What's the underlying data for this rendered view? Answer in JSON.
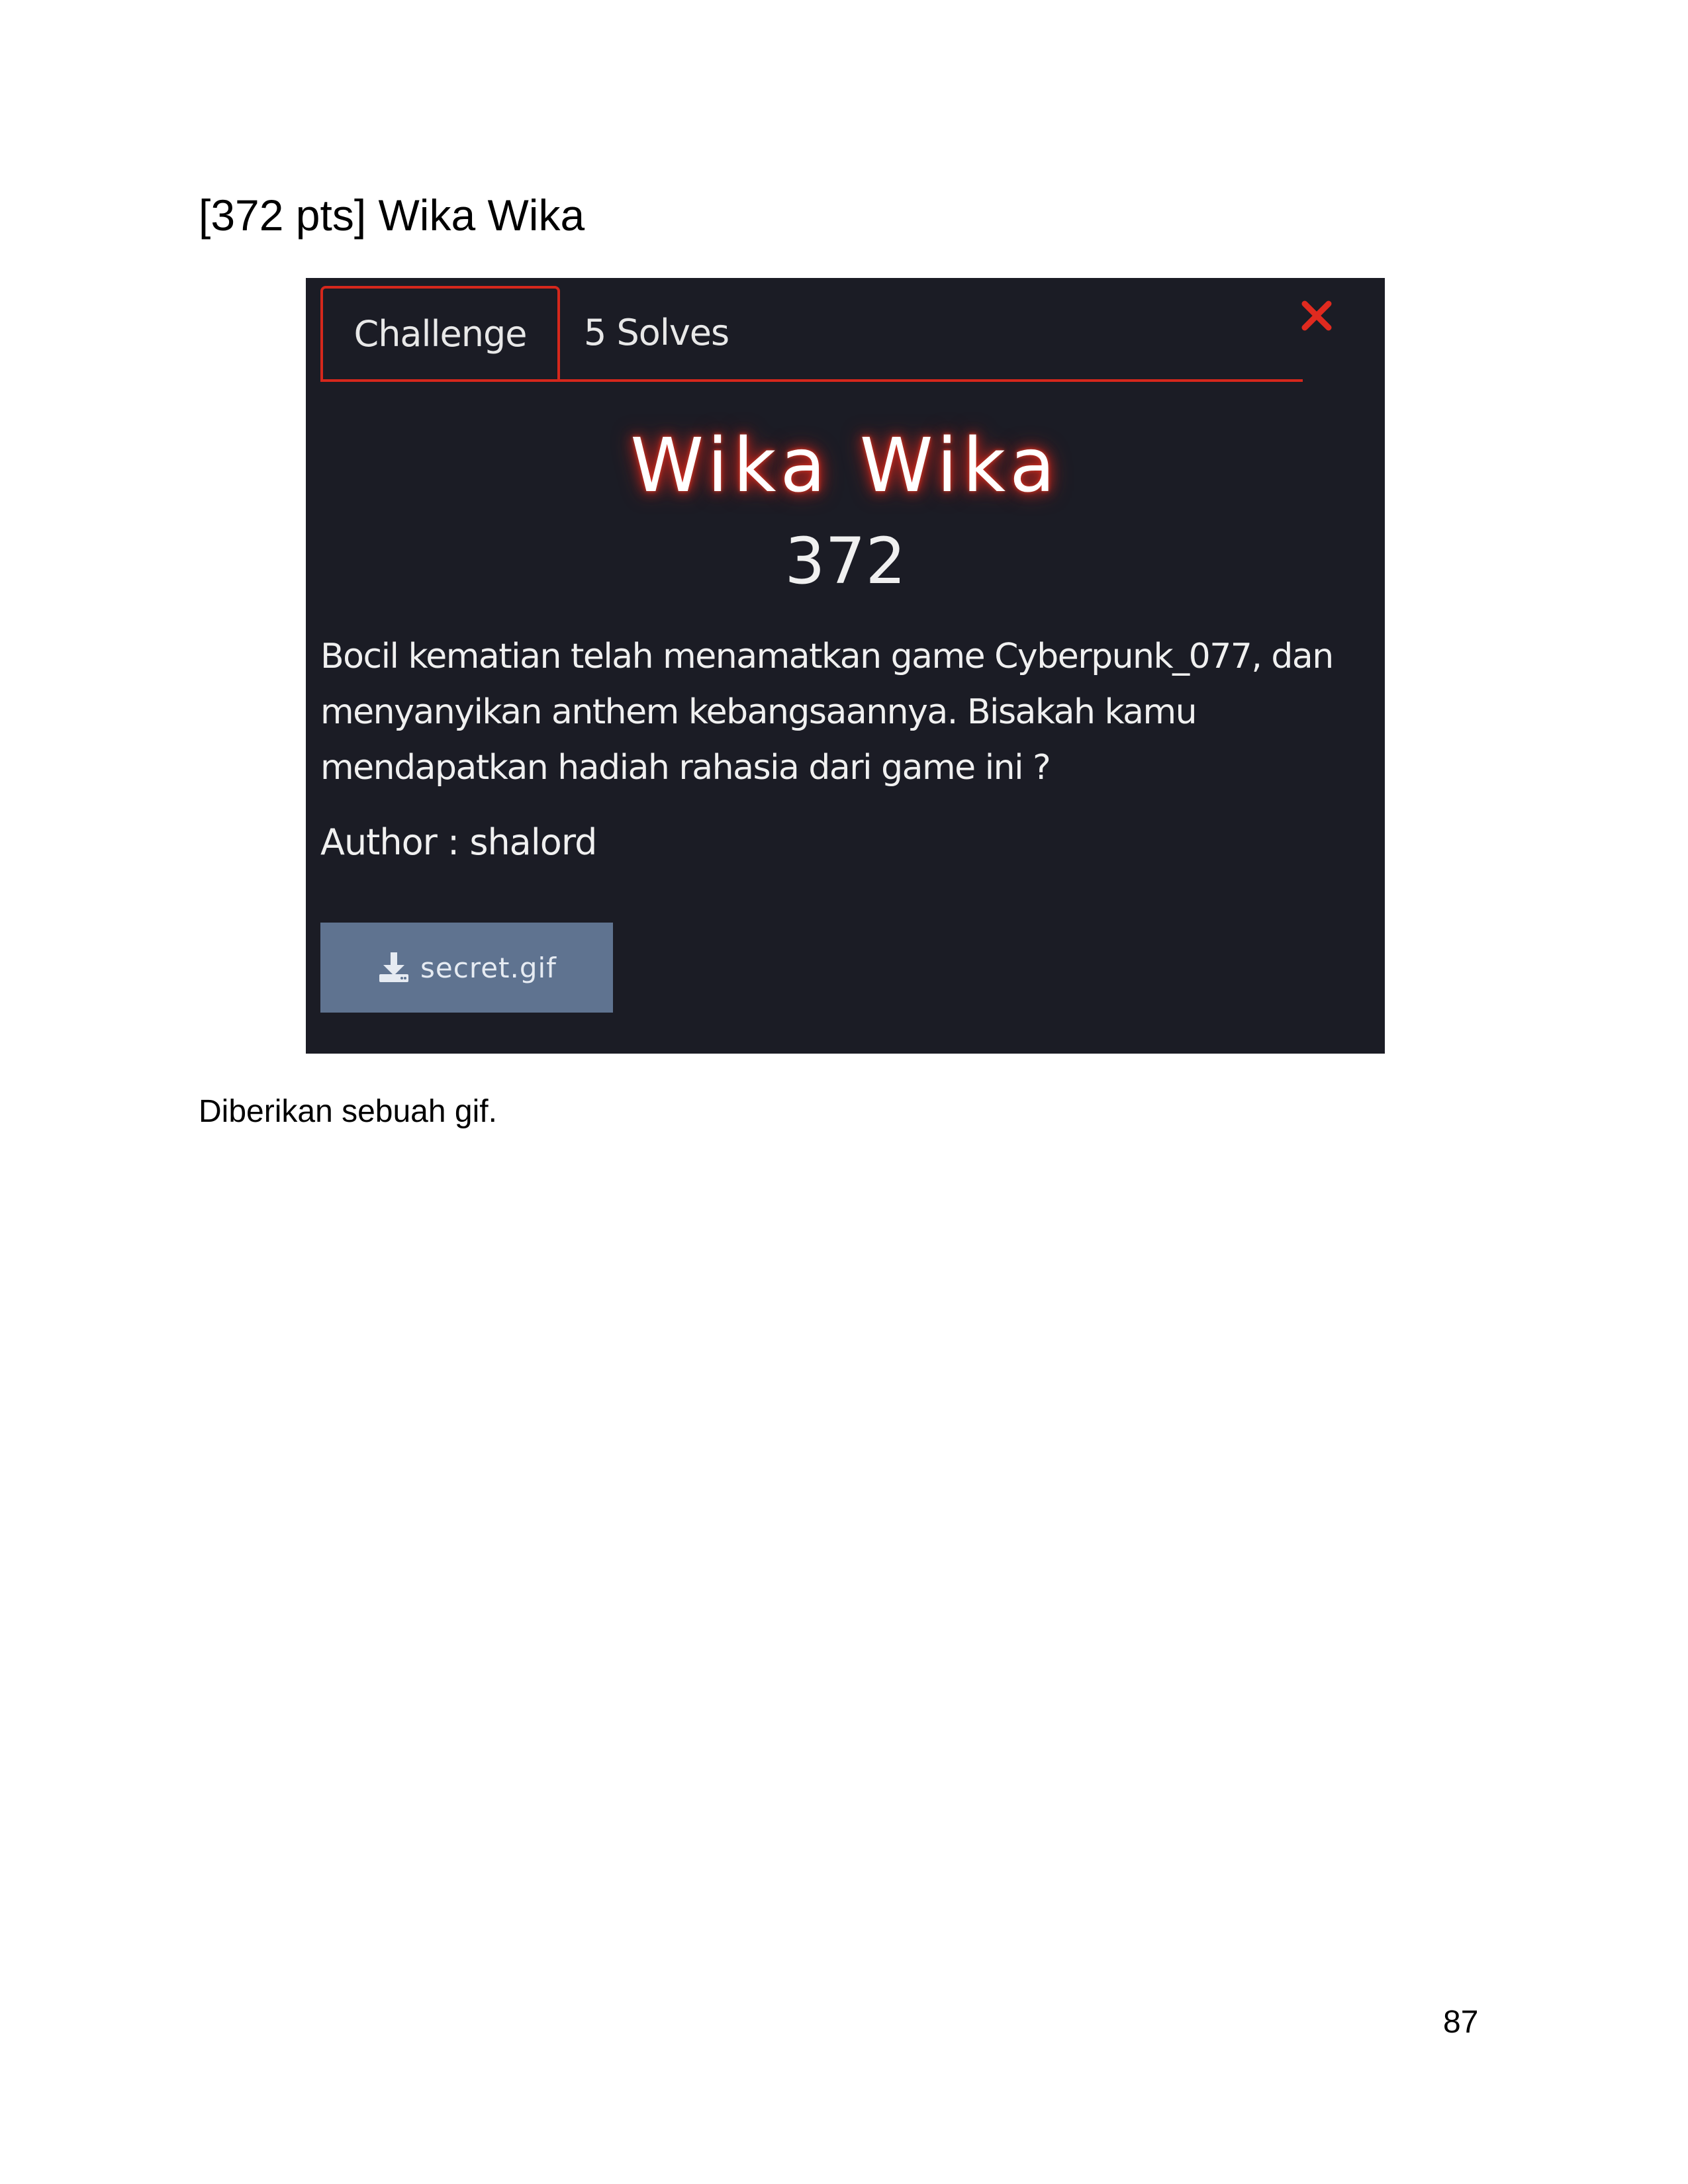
{
  "document": {
    "heading": "[372 pts] Wika Wika",
    "caption": "Diberikan sebuah gif.",
    "page_number": "87"
  },
  "challenge_modal": {
    "tabs": [
      {
        "label": "Challenge",
        "active": true
      },
      {
        "label": "5 Solves",
        "active": false
      }
    ],
    "close_icon": "close-x-icon",
    "title": "Wika Wika",
    "points": "372",
    "description": "Bocil kematian telah menamatkan game Cyberpunk_077, dan menyanyikan anthem kebangsaannya. Bisakah kamu mendapatkan hadiah rahasia dari game ini ?",
    "author": "Author : shalord",
    "file_button": {
      "icon": "download-icon",
      "label": "secret.gif"
    },
    "colors": {
      "background": "#1b1c25",
      "accent": "#d5271c",
      "button": "#5f7390",
      "text": "#f0f0f0"
    }
  }
}
